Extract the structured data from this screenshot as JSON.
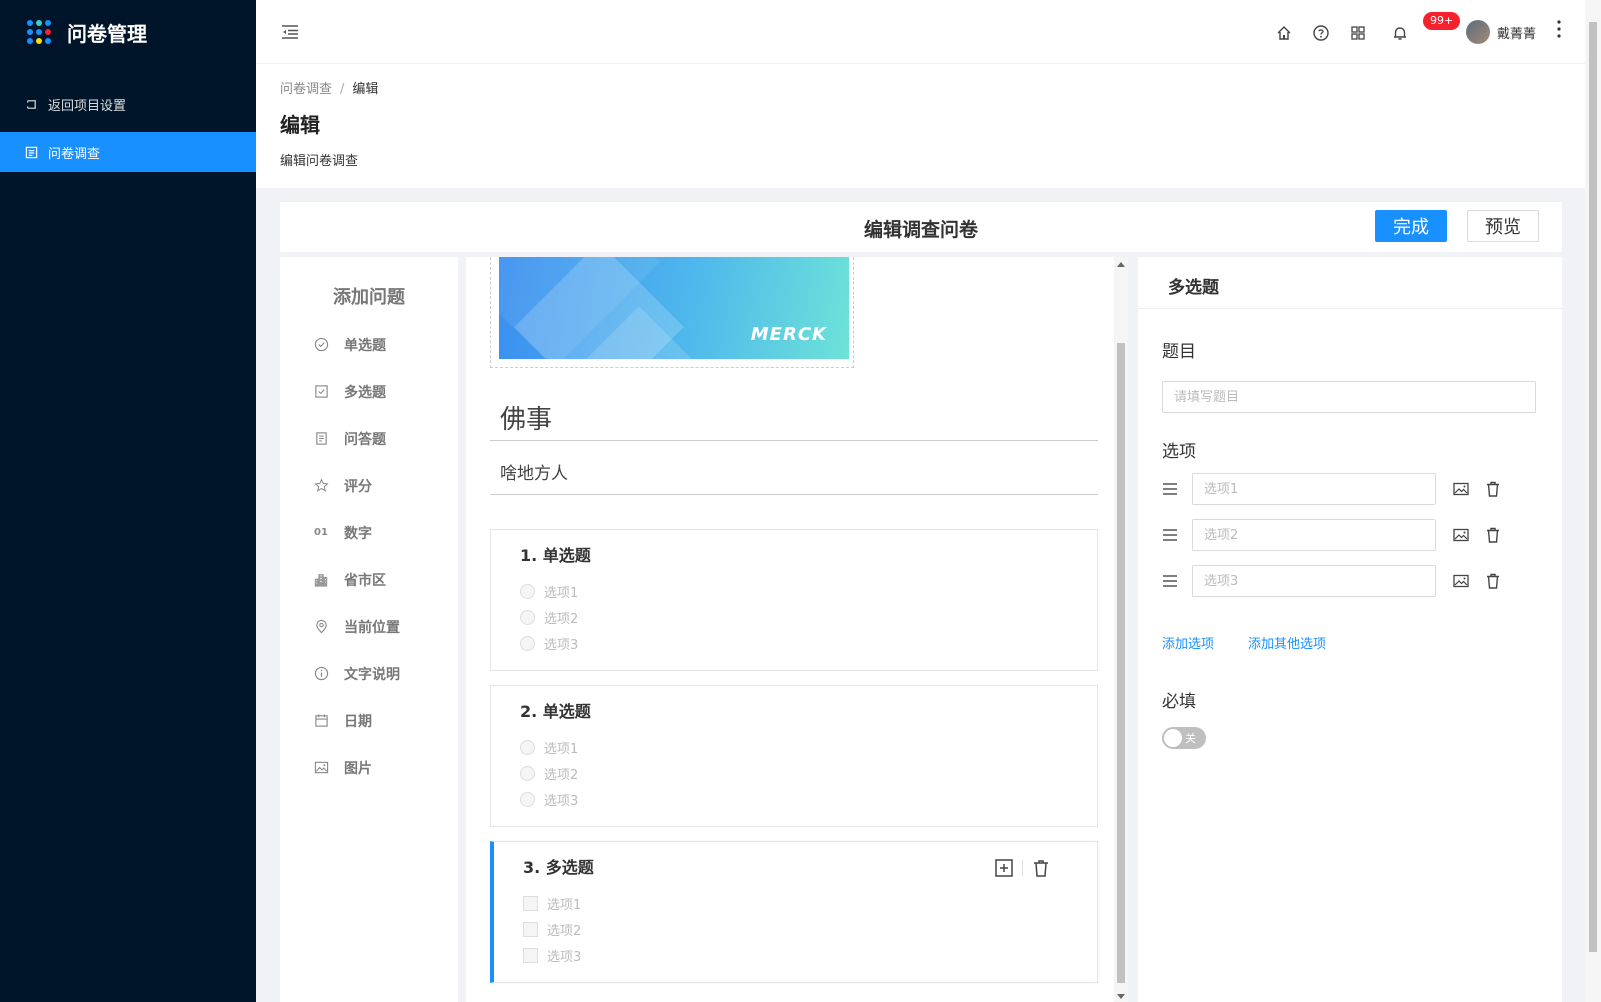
{
  "sidebar": {
    "app_title": "问卷管理",
    "items": [
      {
        "label": "返回项目设置",
        "icon": "back-icon"
      },
      {
        "label": "问卷调查",
        "icon": "form-icon",
        "active": true
      }
    ]
  },
  "header": {
    "badge": "99+",
    "username": "戴菁菁",
    "icons": [
      "home-icon",
      "help-icon",
      "apps-icon",
      "bell-icon",
      "more-icon"
    ]
  },
  "page": {
    "breadcrumb": [
      "问卷调查",
      "编辑"
    ],
    "title": "编辑",
    "subtitle": "编辑问卷调查"
  },
  "editor": {
    "title": "编辑调查问卷",
    "done_label": "完成",
    "preview_label": "预览"
  },
  "question_types": {
    "title": "添加问题",
    "items": [
      {
        "label": "单选题",
        "icon": "radio-circle-icon"
      },
      {
        "label": "多选题",
        "icon": "checkbox-icon"
      },
      {
        "label": "问答题",
        "icon": "text-doc-icon"
      },
      {
        "label": "评分",
        "icon": "star-icon"
      },
      {
        "label": "数字",
        "icon": "number-icon",
        "glyph": "01"
      },
      {
        "label": "省市区",
        "icon": "building-icon"
      },
      {
        "label": "当前位置",
        "icon": "location-pin-icon"
      },
      {
        "label": "文字说明",
        "icon": "info-icon"
      },
      {
        "label": "日期",
        "icon": "calendar-icon"
      },
      {
        "label": "图片",
        "icon": "image-icon"
      }
    ]
  },
  "survey": {
    "banner_brand": "MERCK",
    "title": "佛事",
    "description": "啥地方人",
    "questions": [
      {
        "title": "1. 单选题",
        "kind": "radio",
        "options": [
          "选项1",
          "选项2",
          "选项3"
        ]
      },
      {
        "title": "2. 单选题",
        "kind": "radio",
        "options": [
          "选项1",
          "选项2",
          "选项3"
        ]
      },
      {
        "title": "3. 多选题",
        "kind": "checkbox",
        "options": [
          "选项1",
          "选项2",
          "选项3"
        ],
        "selected": true
      }
    ]
  },
  "properties": {
    "heading": "多选题",
    "question_label": "题目",
    "question_placeholder": "请填写题目",
    "options_label": "选项",
    "options": [
      {
        "placeholder": "选项1"
      },
      {
        "placeholder": "选项2"
      },
      {
        "placeholder": "选项3"
      }
    ],
    "add_option": "添加选项",
    "add_other_option": "添加其他选项",
    "required_label": "必填",
    "required_toggle_text": "关",
    "required": false
  },
  "colors": {
    "sidebar_bg": "#001529",
    "accent": "#1890ff",
    "badge": "#f5222d"
  }
}
